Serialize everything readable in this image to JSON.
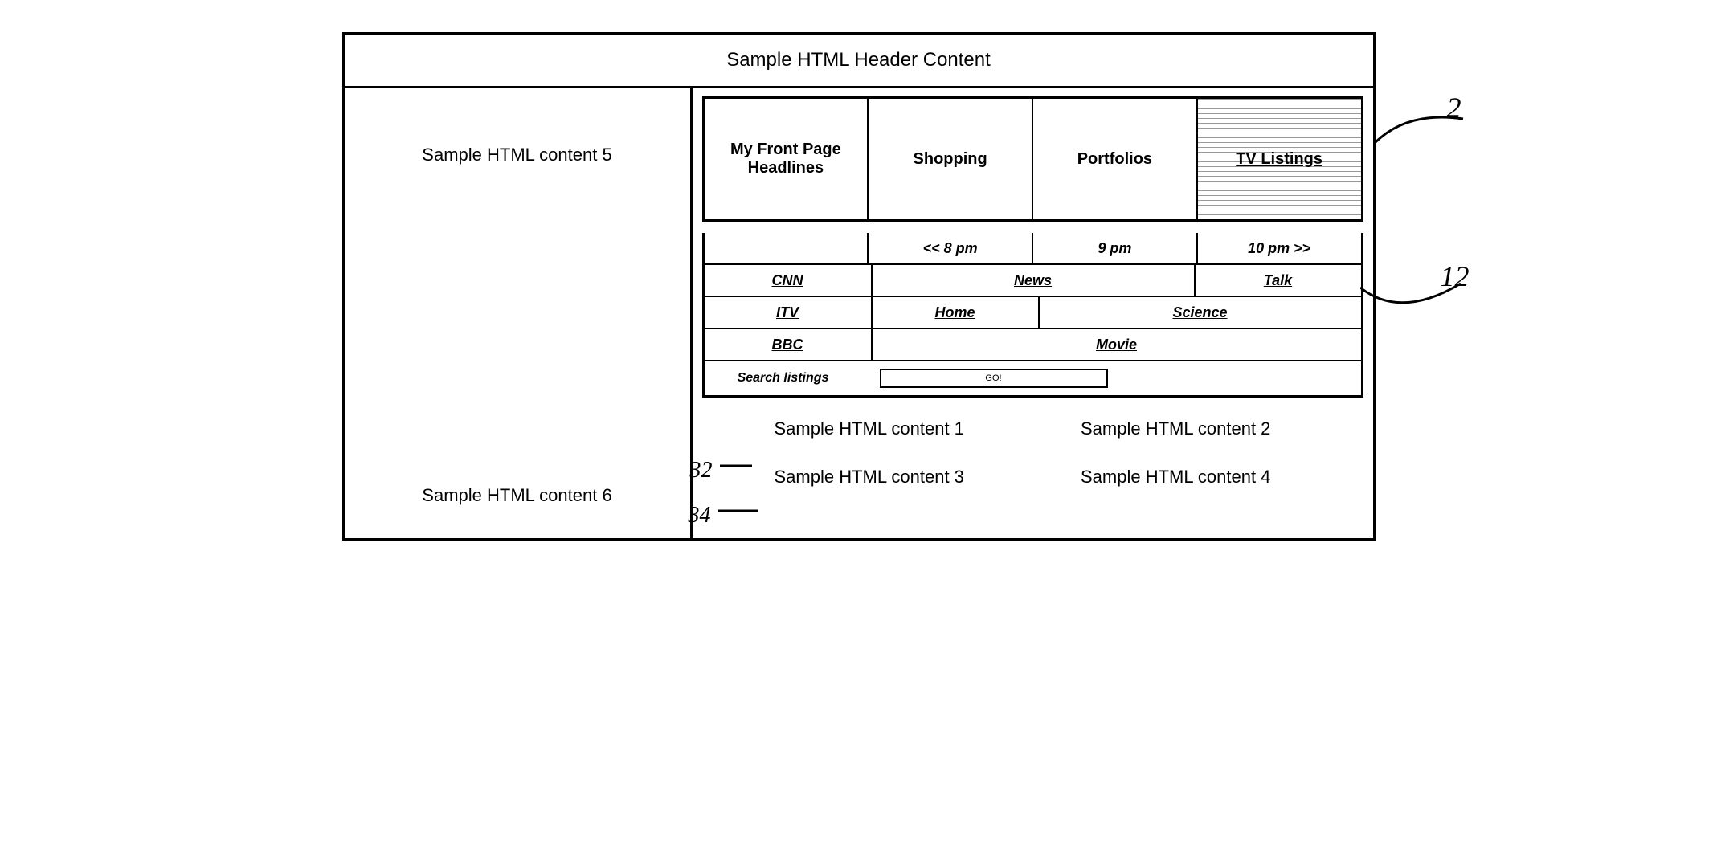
{
  "header": "Sample HTML Header Content",
  "left": {
    "top": "Sample HTML content 5",
    "bottom": "Sample HTML content 6"
  },
  "tabs": [
    "My Front Page Headlines",
    "Shopping",
    "Portfolios",
    "TV Listings"
  ],
  "times": {
    "prev": "<< 8 pm",
    "mid": "9 pm",
    "next": "10 pm >>"
  },
  "channels": {
    "cnn": {
      "name": "CNN",
      "a": "News",
      "b": "Talk"
    },
    "itv": {
      "name": "ITV",
      "a": "Home",
      "b": "Science"
    },
    "bbc": {
      "name": "BBC",
      "a": "Movie"
    }
  },
  "search": {
    "label": "Search listings",
    "button": "GO!"
  },
  "content": {
    "c1": "Sample HTML content 1",
    "c2": "Sample HTML content 2",
    "c3": "Sample HTML content 3",
    "c4": "Sample HTML content 4"
  },
  "callouts": {
    "top": "2",
    "mid": "12",
    "l32": "32",
    "l34": "34"
  }
}
